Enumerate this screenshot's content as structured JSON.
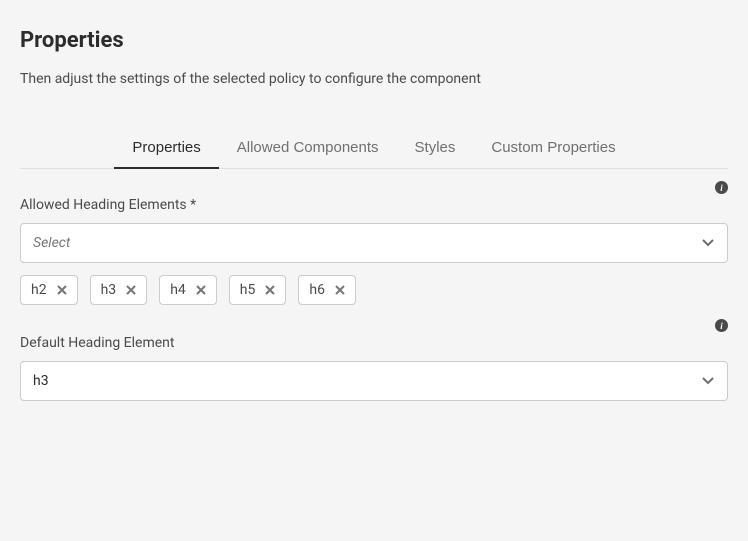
{
  "header": {
    "title": "Properties",
    "subtitle": "Then adjust the settings of the selected policy to configure the component"
  },
  "tabs": {
    "items": [
      {
        "label": "Properties",
        "active": true
      },
      {
        "label": "Allowed Components",
        "active": false
      },
      {
        "label": "Styles",
        "active": false
      },
      {
        "label": "Custom Properties",
        "active": false
      }
    ]
  },
  "fields": {
    "allowedHeadings": {
      "label": "Allowed Heading Elements *",
      "placeholder": "Select",
      "tags": [
        "h2",
        "h3",
        "h4",
        "h5",
        "h6"
      ]
    },
    "defaultHeading": {
      "label": "Default Heading Element",
      "value": "h3"
    }
  }
}
